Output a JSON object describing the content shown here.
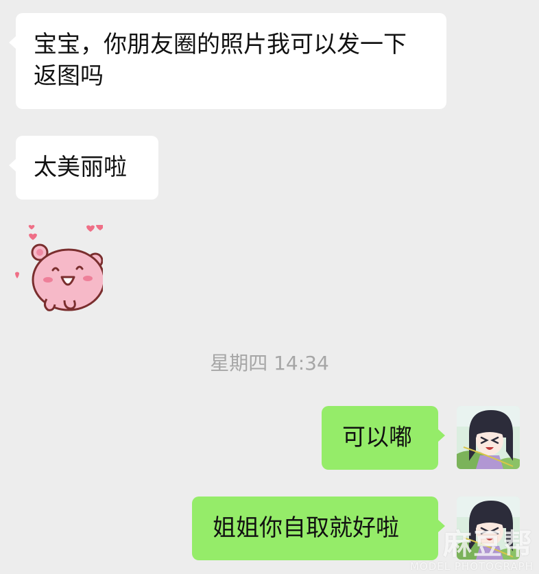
{
  "colors": {
    "background": "#ededed",
    "incoming_bubble": "#ffffff",
    "outgoing_bubble": "#95ec69",
    "timestamp_text": "#a6a6a6"
  },
  "messages": {
    "m1": {
      "direction": "incoming",
      "text": "宝宝，你朋友圈的照片我可以发一下返图吗"
    },
    "m2": {
      "direction": "incoming",
      "text": "太美丽啦"
    },
    "m3": {
      "direction": "incoming",
      "type": "sticker",
      "icon": "pink-bear-sticker-icon"
    },
    "timestamp": "星期四 14:34",
    "m4": {
      "direction": "outgoing",
      "text": "可以嘟"
    },
    "m5": {
      "direction": "outgoing",
      "text": "姐姐你自取就好啦"
    }
  },
  "avatar": {
    "icon": "anime-girl-avatar-icon"
  },
  "watermark": {
    "main": "麻豆帮",
    "sub": "MODEL PHOTOGRAPH"
  }
}
